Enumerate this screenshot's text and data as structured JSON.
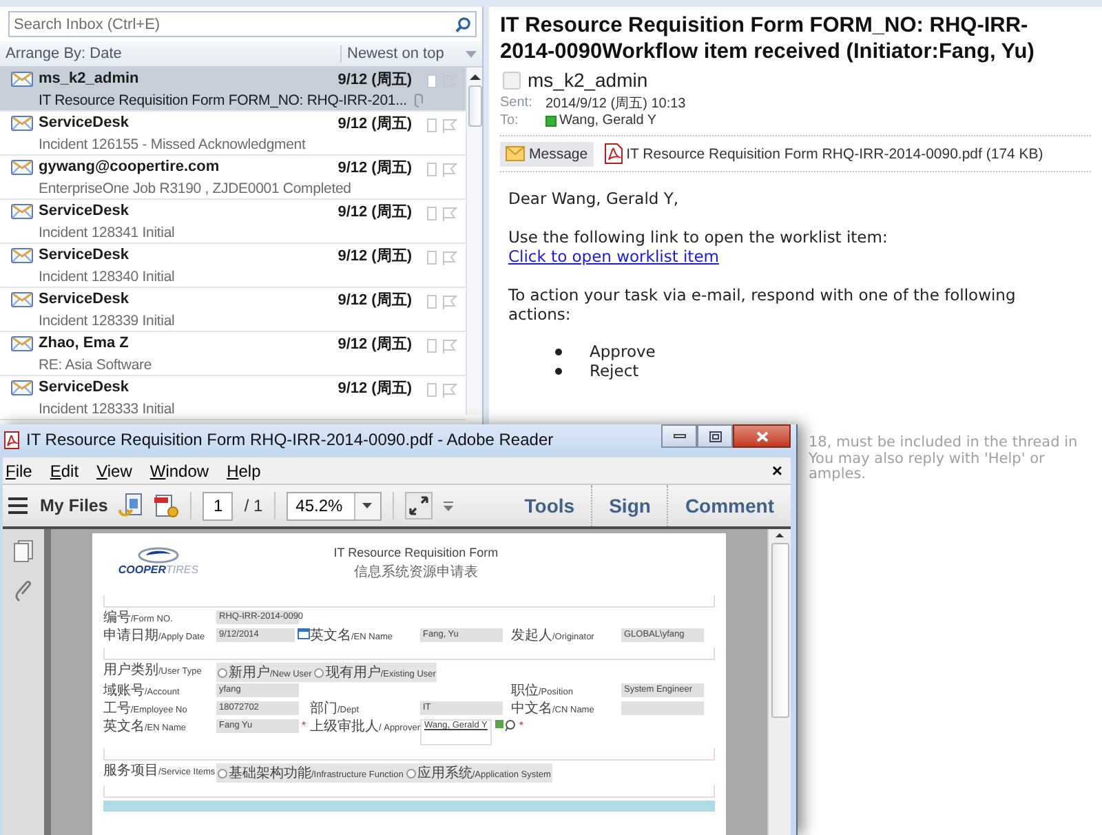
{
  "mail_list": {
    "search_placeholder": "Search Inbox (Ctrl+E)",
    "arrange_by": "Arrange By: Date",
    "sort_order": "Newest on top",
    "messages": [
      {
        "sender": "ms_k2_admin",
        "date": "9/12 (周五)",
        "subject": "IT Resource Requisition Form FORM_NO: RHQ-IRR-201...",
        "selected": true,
        "attachment": true
      },
      {
        "sender": "ServiceDesk",
        "date": "9/12 (周五)",
        "subject": "Incident 126155 - Missed Acknowledgment",
        "selected": false,
        "attachment": false
      },
      {
        "sender": "gywang@coopertire.com",
        "date": "9/12 (周五)",
        "subject": "EnterpriseOne Job R3190 , ZJDE0001 Completed",
        "selected": false,
        "attachment": false
      },
      {
        "sender": "ServiceDesk",
        "date": "9/12 (周五)",
        "subject": "Incident 128341 Initial",
        "selected": false,
        "attachment": false
      },
      {
        "sender": "ServiceDesk",
        "date": "9/12 (周五)",
        "subject": "Incident 128340 Initial",
        "selected": false,
        "attachment": false
      },
      {
        "sender": "ServiceDesk",
        "date": "9/12 (周五)",
        "subject": "Incident 128339 Initial",
        "selected": false,
        "attachment": false
      },
      {
        "sender": "Zhao, Ema Z",
        "date": "9/12 (周五)",
        "subject": "RE: Asia Software",
        "selected": false,
        "attachment": false
      },
      {
        "sender": "ServiceDesk",
        "date": "9/12 (周五)",
        "subject": "Incident 128333 Initial",
        "selected": false,
        "attachment": false
      }
    ]
  },
  "reading_pane": {
    "subject": "IT Resource Requisition Form FORM_NO: RHQ-IRR-2014-0090Workflow item received (Initiator:Fang, Yu)",
    "sender": "ms_k2_admin",
    "sent_label": "Sent:",
    "sent": "2014/9/12 (周五) 10:13",
    "to_label": "To:",
    "to": "Wang, Gerald Y",
    "attachments": [
      {
        "kind": "message",
        "label": "Message",
        "selected": true
      },
      {
        "kind": "pdf",
        "label": "IT Resource Requisition Form RHQ-IRR-2014-0090.pdf (174 KB)",
        "selected": false
      }
    ],
    "body": {
      "greeting": "Dear Wang, Gerald Y,",
      "instruction": "Use the following link to open the worklist item:",
      "link": "Click to open worklist item",
      "prompt": "To action your task via e-mail, respond with one of the following actions:",
      "actions": [
        "Approve",
        "Reject"
      ],
      "partial_lines": [
        "18, must be included in the thread in",
        "You may also reply with 'Help' or",
        "amples."
      ]
    }
  },
  "pdf_window": {
    "title": "IT Resource Requisition Form RHQ-IRR-2014-0090.pdf - Adobe Reader",
    "menu": [
      "File",
      "Edit",
      "View",
      "Window",
      "Help"
    ],
    "close_document": "×",
    "toolbar": {
      "my_files": "My Files",
      "page": "1",
      "page_total": "/ 1",
      "zoom": "45.2%",
      "tools": "Tools",
      "sign": "Sign",
      "comment": "Comment"
    },
    "form": {
      "logo": "**COOPER**TIRES",
      "title_en": "IT Resource Requisition Form",
      "title_cn": "信息系统资源申请表",
      "sections": [
        {
          "rows": [
            [
              {
                "kind": "text",
                "label": "编号/Form NO.",
                "value": "RHQ-IRR-2014-0090"
              }
            ],
            [
              {
                "kind": "date",
                "label": "申请日期/Apply Date",
                "value": "9/12/2014"
              },
              {
                "kind": "text",
                "label": "英文名/EN Name",
                "value": "Fang, Yu"
              },
              {
                "kind": "text",
                "label": "发起人/Originator",
                "value": "GLOBAL\\yfang"
              }
            ]
          ]
        },
        {
          "rows": [
            [
              {
                "kind": "radio",
                "label": "用户类别/User Type",
                "options": [
                  {
                    "label": "新用户/New User",
                    "selected": false
                  },
                  {
                    "label": "现有用户/Existing User",
                    "selected": false
                  }
                ]
              }
            ],
            [
              {
                "kind": "text",
                "label": "域账号/Account",
                "value": "yfang"
              },
              {
                "kind": "blank"
              },
              {
                "kind": "text",
                "label": "职位/Position",
                "value": "System Engineer"
              }
            ],
            [
              {
                "kind": "text",
                "label": "工号/Employee No",
                "value": "18072702"
              },
              {
                "kind": "text",
                "label": "部门/Dept",
                "value": "IT"
              },
              {
                "kind": "text",
                "label": "中文名/CN Name"
              }
            ],
            [
              {
                "kind": "text",
                "label": "英文名/EN Name",
                "value": "Fang Yu",
                "required_mark": "*"
              },
              {
                "kind": "lookup",
                "label": "上级审批人/ Approver",
                "value": "Wang, Gerald Y",
                "required_mark": "*"
              }
            ]
          ]
        },
        {
          "rows": [
            [
              {
                "kind": "radio",
                "label": "服务项目/Service Items",
                "options": [
                  {
                    "label": "基础架构功能/Infrastructure Function",
                    "selected": false
                  },
                  {
                    "label": "应用系统/Application System",
                    "selected": false
                  }
                ]
              }
            ]
          ]
        }
      ]
    }
  }
}
